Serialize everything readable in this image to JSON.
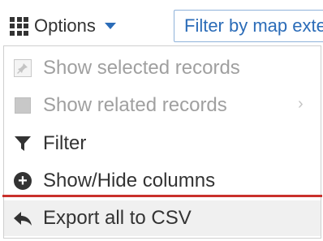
{
  "toolbar": {
    "options_label": "Options",
    "filter_placeholder": "Filter by map extent"
  },
  "menu": {
    "items": [
      {
        "label": "Show selected records",
        "enabled": false,
        "icon": "pin-icon"
      },
      {
        "label": "Show related records",
        "enabled": false,
        "icon": "square-icon",
        "submenu": true
      },
      {
        "label": "Filter",
        "enabled": true,
        "icon": "funnel-icon"
      },
      {
        "label": "Show/Hide columns",
        "enabled": true,
        "icon": "plus-circle-icon"
      },
      {
        "label": "Export all to CSV",
        "enabled": true,
        "icon": "export-arrow-icon"
      }
    ]
  },
  "colors": {
    "accent": "#2b6cb8",
    "disabled_text": "#a0a0a0",
    "highlight_line": "#c9302c"
  }
}
